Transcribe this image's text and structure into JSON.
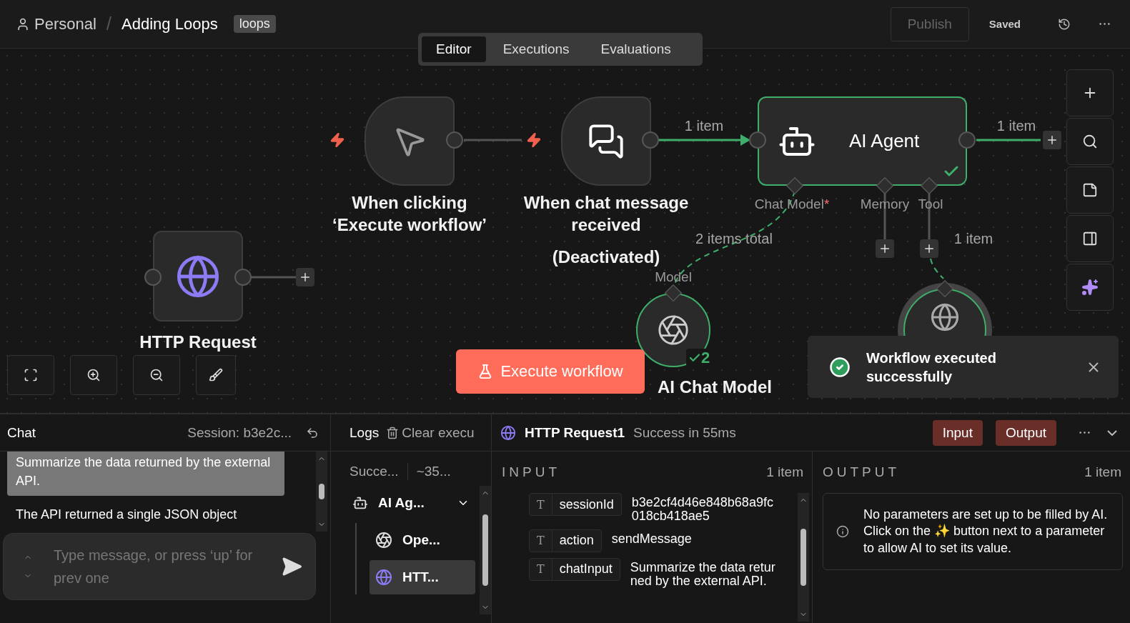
{
  "header": {
    "project": "Personal",
    "separator": "/",
    "workflow": "Adding Loops",
    "tag": "loops",
    "publish": {
      "label": "Publish",
      "disabled": true
    },
    "status": "Saved"
  },
  "view_tabs": [
    {
      "label": "Editor",
      "selected": true
    },
    {
      "label": "Executions",
      "selected": false
    },
    {
      "label": "Evaluations",
      "selected": false
    }
  ],
  "canvas": {
    "nodes": [
      {
        "kind": "manual",
        "title": "When clicking ‘Execute workflow’",
        "success": false
      },
      {
        "kind": "chat",
        "title": "When chat message received",
        "status_label": "(Deactivated)",
        "success": false
      },
      {
        "kind": "agent",
        "title": "AI Agent",
        "success": true,
        "inputs": [
          {
            "label": "Chat Model",
            "required_mark": "*"
          },
          {
            "label": "Memory"
          },
          {
            "label": "Tool"
          }
        ]
      },
      {
        "kind": "http",
        "title": "HTTP Request",
        "success": false
      },
      {
        "kind": "model",
        "title": "AI Chat Model",
        "input_label": "Model",
        "success": true,
        "run_count": "2"
      },
      {
        "kind": "tool",
        "success": true
      }
    ],
    "edges": [
      {
        "kind": "main",
        "success": false
      },
      {
        "kind": "main",
        "success": true,
        "label": "1 item"
      },
      {
        "kind": "main",
        "success": true,
        "label": "1 item"
      },
      {
        "kind": "ai",
        "success": true,
        "label": "2 items total"
      },
      {
        "kind": "ai",
        "success": true,
        "label": "1 item"
      }
    ],
    "execute_button": "Execute workflow",
    "toast": {
      "message": "Workflow executed successfully"
    }
  },
  "chat": {
    "title": "Chat",
    "session": "Session: b3e2c...",
    "messages": [
      {
        "kind": "user",
        "text": "Summarize the data returned by the external API."
      },
      {
        "kind": "bot",
        "text": "The API returned a single JSON object"
      }
    ],
    "placeholder": "Type message, or press ‘up’ for prev one"
  },
  "logs": {
    "title": "Logs",
    "clear": "Clear execu",
    "status": "Succe...",
    "duration": "~35...",
    "entries": [
      {
        "kind": "agent",
        "label": "AI Ag...",
        "expanded": true,
        "selected": false,
        "children": [
          {
            "kind": "model",
            "label": "Ope...",
            "selected": false
          },
          {
            "kind": "http",
            "label": "HTT...",
            "selected": true
          }
        ]
      }
    ]
  },
  "detail": {
    "node": "HTTP Request1",
    "status": "Success in 55ms",
    "buttons": [
      "Input",
      "Output"
    ],
    "input": {
      "title": "INPUT",
      "count": "1 item",
      "fields": [
        {
          "type": "T",
          "key": "sessionId",
          "value": "b3e2cf4d46e848b68a9fc018cb418ae5"
        },
        {
          "type": "T",
          "key": "action",
          "value": "sendMessage"
        },
        {
          "type": "T",
          "key": "chatInput",
          "value": "Summarize the data returned by the external API."
        }
      ]
    },
    "output": {
      "title": "OUTPUT",
      "count": "1 item",
      "notice": "No parameters are set up to be filled by AI. Click on the ✨ button next to a parameter to allow AI to set its value."
    }
  }
}
